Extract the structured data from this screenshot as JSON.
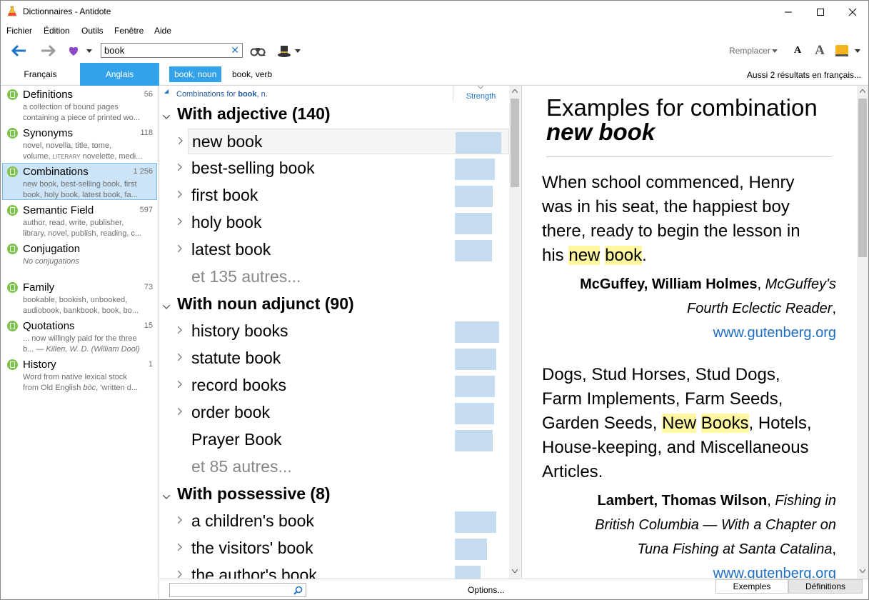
{
  "window": {
    "title": "Dictionnaires - Antidote"
  },
  "menu": [
    "Fichier",
    "Édition",
    "Outils",
    "Fenêtre",
    "Aide"
  ],
  "toolbar": {
    "search_value": "book",
    "replace_label": "Remplacer",
    "font_small": "A",
    "font_large": "A"
  },
  "tabs": {
    "french": "Français",
    "english": "Anglais"
  },
  "entries": {
    "noun": "book, noun",
    "verb": "book, verb",
    "also": "Aussi 2 résultats en français..."
  },
  "sidebar": [
    {
      "title": "Definitions",
      "count": "56",
      "desc1": "a collection of bound pages",
      "desc2": "containing a piece of printed wo..."
    },
    {
      "title": "Synonyms",
      "count": "118",
      "desc1": "novel, novella, title, tome,",
      "desc2_pre": "volume, ",
      "desc2_tag": "LITERARY",
      "desc2_post": " novelette, medi..."
    },
    {
      "title": "Combinations",
      "count": "1 256",
      "desc1": "new book, best-selling book, first",
      "desc2": "book, holy book, latest book, fa..."
    },
    {
      "title": "Semantic Field",
      "count": "597",
      "desc1": "author, read, write, publisher,",
      "desc2": "library, novel, publish, reading, c..."
    },
    {
      "title": "Conjugation",
      "count": "",
      "desc1": "No conjugations",
      "desc2": ""
    },
    {
      "title": "Family",
      "count": "73",
      "desc1": "bookable, bookish, unbooked,",
      "desc2": "audiobook, bankbook, book, bo..."
    },
    {
      "title": "Quotations",
      "count": "15",
      "desc1": "... now willingly paid for the three",
      "desc2_pre": "b... — ",
      "desc2_it": "Killen, W. D. (William Dool)"
    },
    {
      "title": "History",
      "count": "1",
      "desc1": "Word from native lexical stock",
      "desc2_pre": "from Old English ",
      "desc2_it": "bōc",
      "desc2_post": ", 'written d..."
    }
  ],
  "middle": {
    "header_pre": "Combinations for ",
    "header_word": "book",
    "header_post": ", n.",
    "strength_label": "Strength",
    "groups": [
      {
        "title": "With adjective (140)",
        "items": [
          {
            "text": "new book",
            "strength": 0.82
          },
          {
            "text": "best-selling book",
            "strength": 0.72
          },
          {
            "text": "first book",
            "strength": 0.68
          },
          {
            "text": "holy book",
            "strength": 0.67
          },
          {
            "text": "latest book",
            "strength": 0.67
          }
        ],
        "more": "et 135 autres..."
      },
      {
        "title": "With noun adjunct (90)",
        "items": [
          {
            "text": "history books",
            "strength": 0.8
          },
          {
            "text": "statute book",
            "strength": 0.74
          },
          {
            "text": "record books",
            "strength": 0.72
          },
          {
            "text": "order book",
            "strength": 0.7
          },
          {
            "text": "Prayer Book",
            "strength": 0.68,
            "nochev": true
          }
        ],
        "more": "et 85 autres..."
      },
      {
        "title": "With possessive (8)",
        "items": [
          {
            "text": "a children's book",
            "strength": 0.74
          },
          {
            "text": "the visitors' book",
            "strength": 0.58
          },
          {
            "text": "the author's book",
            "strength": 0.46
          }
        ]
      }
    ],
    "options": "Options..."
  },
  "right": {
    "heading_line1": "Examples for combination",
    "heading_line2": "new book",
    "ex1": {
      "l1": "When school commenced, Henry",
      "l2": "was in his seat, the happiest boy",
      "l3": "there, ready to begin the lesson in",
      "l4_pre": "his ",
      "l4_h1": "new",
      "l4_h2": "book",
      "l4_post": ".",
      "author": "McGuffey, William Holmes",
      "work1": "McGuffey's",
      "work2": "Fourth Eclectic Reader",
      "link": "www.gutenberg.org"
    },
    "ex2": {
      "l1": "Dogs, Stud Horses, Stud Dogs,",
      "l2": "Farm Implements, Farm Seeds,",
      "l3_pre": "Garden Seeds, ",
      "l3_h1": "New",
      "l3_h2": "Books",
      "l3_post": ", Hotels,",
      "l4": "House-keeping, and Miscellaneous",
      "l5": "Articles.",
      "author": "Lambert, Thomas Wilson",
      "work1": "Fishing in",
      "work2": "British Columbia — With a Chapter on",
      "work3": "Tuna Fishing at Santa Catalina",
      "link": "www.gutenberg.org"
    },
    "footer_tabs": {
      "examples": "Exemples",
      "definitions": "Définitions"
    }
  },
  "colors": {
    "accent": "#33a2e9",
    "strength_bar": "#c5dcf0",
    "highlight": "#fff7a1",
    "link": "#1e6fc2",
    "status_dot": "#7ec34b"
  }
}
